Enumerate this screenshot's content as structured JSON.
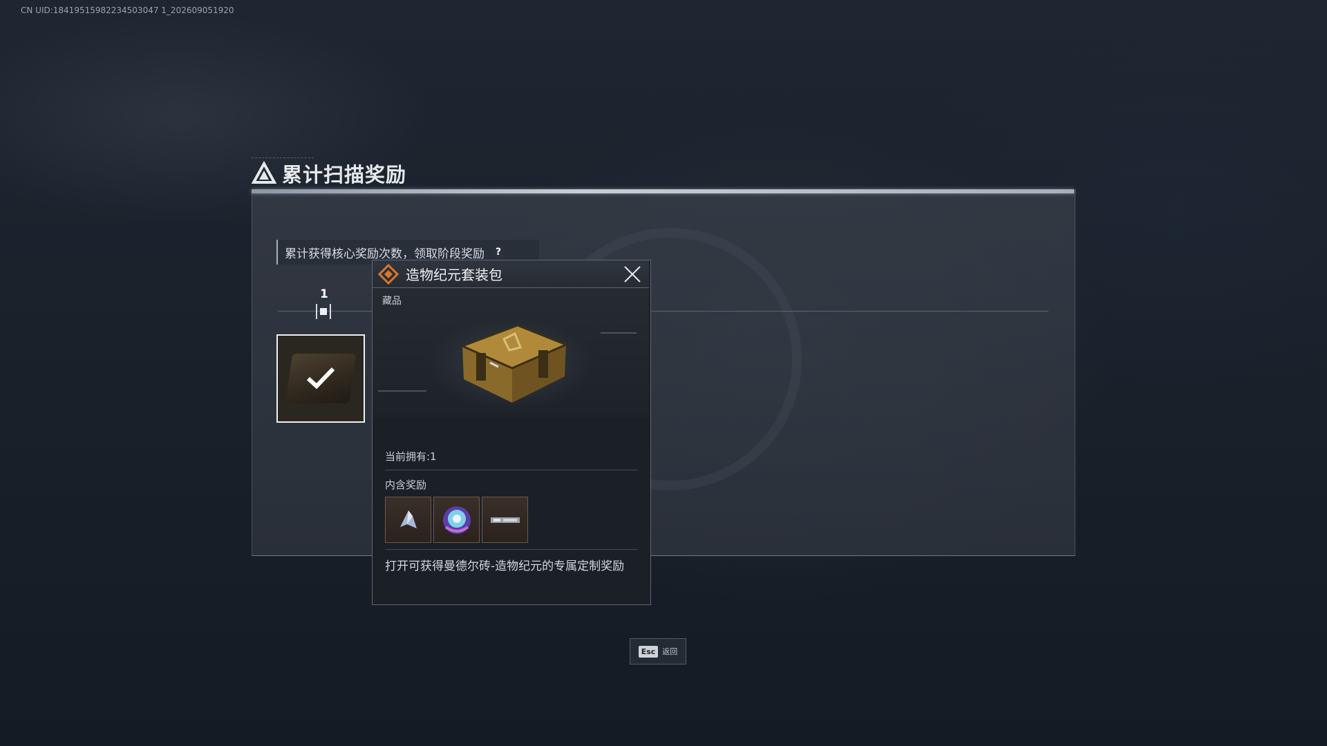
{
  "uid_text": "CN UID:18419515982234503047 1_202609051920",
  "header": {
    "title": "累计扫描奖励",
    "icon": "triangle-logo-icon"
  },
  "hint": {
    "text": "累计获得核心奖励次数，领取阶段奖励",
    "help_label": "?"
  },
  "stage": {
    "number": "1"
  },
  "reward_card": {
    "icon": "chest-icon",
    "claimed": true
  },
  "popup": {
    "title": "造物纪元套装包",
    "category": "藏品",
    "owned_text": "当前拥有:1",
    "contains_label": "内含奖励",
    "reward_slots": [
      {
        "icon": "crystal-shard-icon"
      },
      {
        "icon": "emblem-orb-icon"
      },
      {
        "icon": "nameplate-banner-icon"
      }
    ],
    "description": "打开可获得曼德尔砖-造物纪元的专属定制奖励"
  },
  "footer": {
    "esc_key": "Esc",
    "esc_label": "返回"
  },
  "colors": {
    "chest_gold": "#b08a3a",
    "accent_orange": "#d9772e",
    "panel_border": "#c8ced5"
  }
}
